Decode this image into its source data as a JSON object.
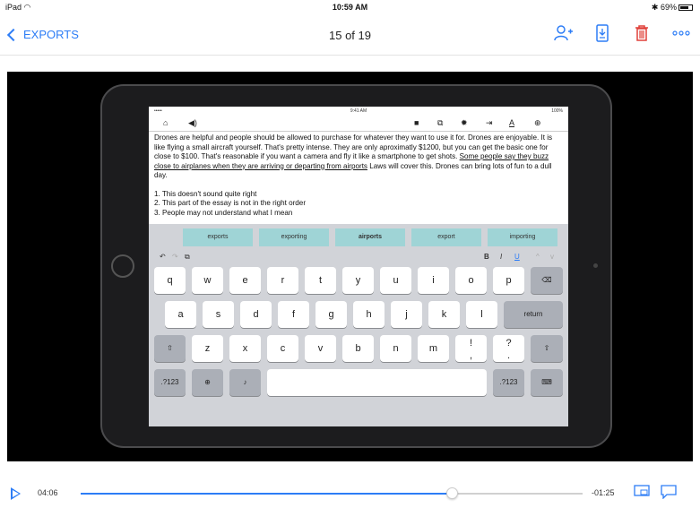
{
  "status_bar": {
    "device": "iPad",
    "time": "10:59 AM",
    "battery": "69%"
  },
  "nav": {
    "back_label": "EXPORTS",
    "title": "15 of 19"
  },
  "colors": {
    "accent": "#2d7df6",
    "delete": "#e0413a",
    "suggestion_bg": "#9fd4d6"
  },
  "inner_status": {
    "carrier": "••••• ",
    "time": "9:41 AM",
    "battery": "100%"
  },
  "document": {
    "paragraph_a": "Drones are helpful and people should be allowed to purchase for whatever they want to use it for.  Drones are enjoyable.  It is like flying a small aircraft yourself.  That's pretty intense.  They are only aproximatly $1200, but you can get the basic one for close to $100.  That's reasonable if you want a camera and fly it like a smartphone to get shots. ",
    "paragraph_underlined": "Some people say they buzz close to airplanes when they are arriving or departing from airports",
    "paragraph_b": " Laws will cover this.  Drones can bring lots of fun to a dull day.",
    "list": [
      "1.  This doesn't sound quite right",
      "2.  This part of the essay is not in the right order",
      "3.  People may not understand what I mean"
    ]
  },
  "suggestions": [
    "exports",
    "exporting",
    "airports",
    "export",
    "importing"
  ],
  "keyboard": {
    "format": {
      "bold": "B",
      "italic": "I",
      "underline": "U"
    },
    "row1": [
      "q",
      "w",
      "e",
      "r",
      "t",
      "y",
      "u",
      "i",
      "o",
      "p"
    ],
    "row2": [
      "a",
      "s",
      "d",
      "f",
      "g",
      "h",
      "j",
      "k",
      "l"
    ],
    "row3": [
      "z",
      "x",
      "c",
      "v",
      "b",
      "n",
      "m",
      "!",
      "?"
    ],
    "row3_alt": [
      ",",
      "."
    ],
    "return_label": "return",
    "numbers_label": ".?123"
  },
  "player": {
    "elapsed": "04:06",
    "remaining": "-01:25",
    "progress_fraction": 0.74
  }
}
